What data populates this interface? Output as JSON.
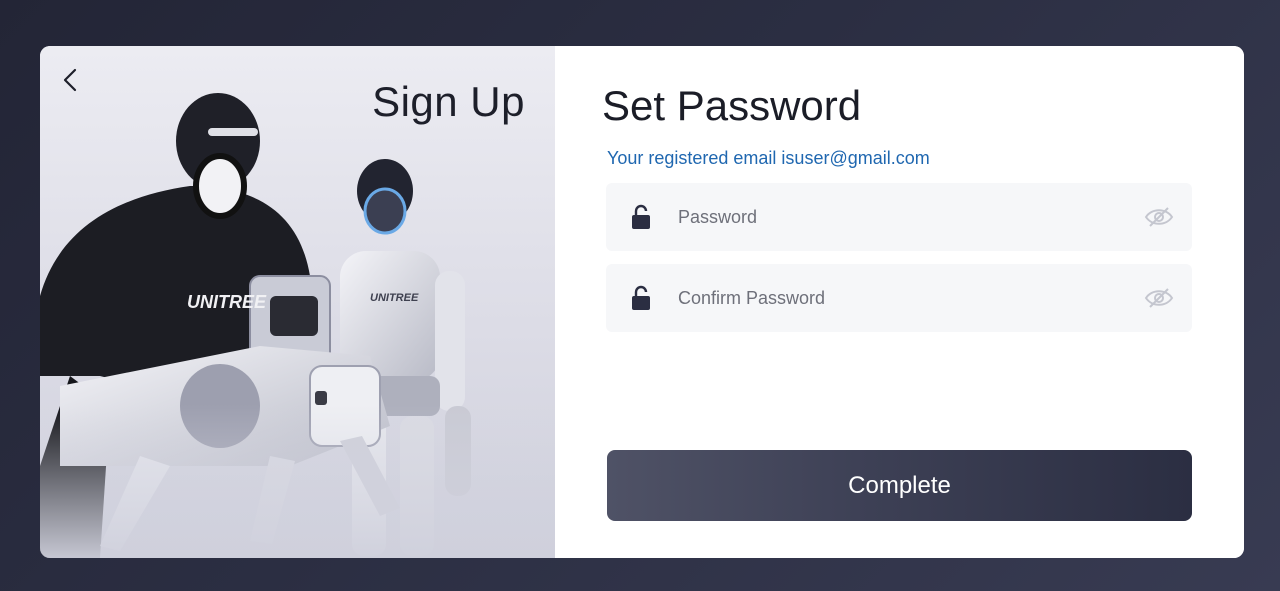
{
  "left_panel": {
    "title": "Sign Up",
    "back_icon": "chevron-left-icon",
    "brand_marks": [
      "UNITREE",
      "UNITREE"
    ]
  },
  "form": {
    "title": "Set Password",
    "email_note": "Your registered email isuser@gmail.com",
    "password": {
      "placeholder": "Password",
      "value": "",
      "lock_icon": "lock-icon",
      "toggle_icon": "eye-hidden-icon"
    },
    "confirm_password": {
      "placeholder": "Confirm Password",
      "value": "",
      "lock_icon": "lock-icon",
      "toggle_icon": "eye-hidden-icon"
    },
    "submit_label": "Complete"
  },
  "colors": {
    "background": "#2b2e42",
    "link_blue": "#1f67b0",
    "button_dark": "#3d4055",
    "field_bg": "#f6f7f9"
  }
}
